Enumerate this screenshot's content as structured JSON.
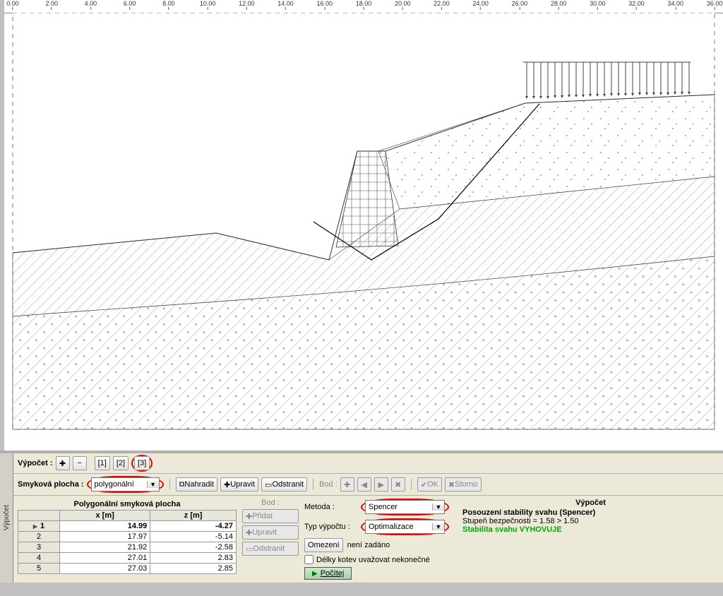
{
  "ruler_ticks": [
    "0.00",
    "2.00",
    "4.00",
    "6.00",
    "8.00",
    "10.00",
    "12.00",
    "14.00",
    "16.00",
    "18.00",
    "20.00",
    "22.00",
    "24.00",
    "26.00",
    "28.00",
    "30.00",
    "32.00",
    "34.00",
    "36.00"
  ],
  "side_tab": "Výpočet",
  "toolbar1": {
    "label": "Výpočet :",
    "tabs": [
      "[1]",
      "[2]",
      "[3]"
    ]
  },
  "toolbar2": {
    "label": "Smyková plocha :",
    "combo_value": "polygonální",
    "btn_replace": "Nahradit",
    "btn_edit": "Upravit",
    "btn_remove": "Odstranit",
    "label_bod": "Bod :",
    "btn_ok": "OK",
    "btn_storno": "Storno"
  },
  "table": {
    "title": "Polygonální smyková plocha",
    "cols": [
      "x [m]",
      "z [m]"
    ],
    "rows": [
      {
        "n": "1",
        "x": "14.99",
        "z": "-4.27",
        "sel": true
      },
      {
        "n": "2",
        "x": "17.97",
        "z": "-5.14"
      },
      {
        "n": "3",
        "x": "21.92",
        "z": "-2.58"
      },
      {
        "n": "4",
        "x": "27.01",
        "z": "2.83"
      },
      {
        "n": "5",
        "x": "27.03",
        "z": "2.85"
      }
    ]
  },
  "edit": {
    "label": "Bod :",
    "btn_add": "Přidat",
    "btn_edit": "Upravit",
    "btn_remove": "Odstranit"
  },
  "method": {
    "label_method": "Metoda :",
    "value_method": "Spencer",
    "label_type": "Typ výpočtu :",
    "value_type": "Optimalizace",
    "btn_limit": "Omezení",
    "limit_text": "není zadáno",
    "chk_label": "Délky kotev uvažovat nekonečné",
    "btn_run": "Počítej"
  },
  "result": {
    "title": "Výpočet",
    "line1": "Posouzení stability svahu (Spencer)",
    "line2": "Stupeň bezpečnosti = 1.58 > 1.50",
    "line3": "Stabilita svahu VYHOVUJE"
  }
}
